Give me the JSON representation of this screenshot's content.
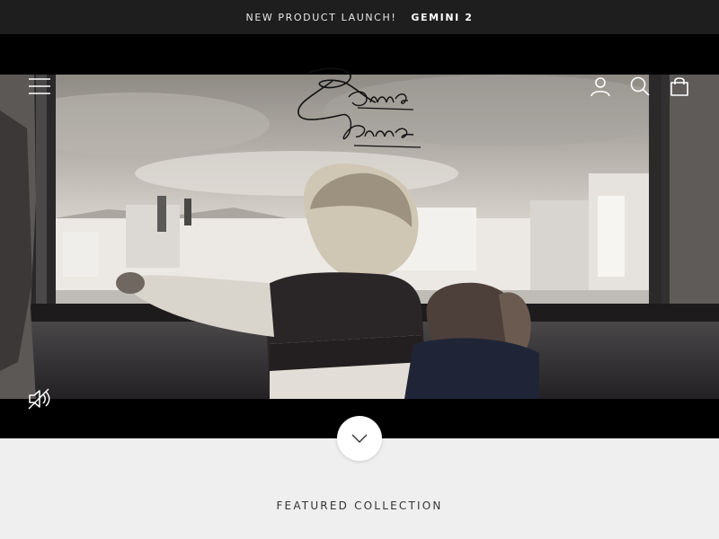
{
  "announcement": {
    "text": "NEW PRODUCT LAUNCH!",
    "highlight": "GEMINI 2",
    "background": "#1e1e1e"
  },
  "header": {
    "logo_text": [
      "Roma",
      "Roma"
    ],
    "icons": [
      "menu-icon",
      "account-icon",
      "search-icon",
      "cart-icon"
    ]
  },
  "hero": {
    "media": "video",
    "icons": [
      "mute-icon"
    ],
    "scroll_icon": "chevron-down-icon"
  },
  "sections": {
    "featured_title": "FEATURED COLLECTION"
  },
  "colors": {
    "page_background": "#efefef",
    "hero_frame": "#000000",
    "icon_white": "#ffffff"
  }
}
